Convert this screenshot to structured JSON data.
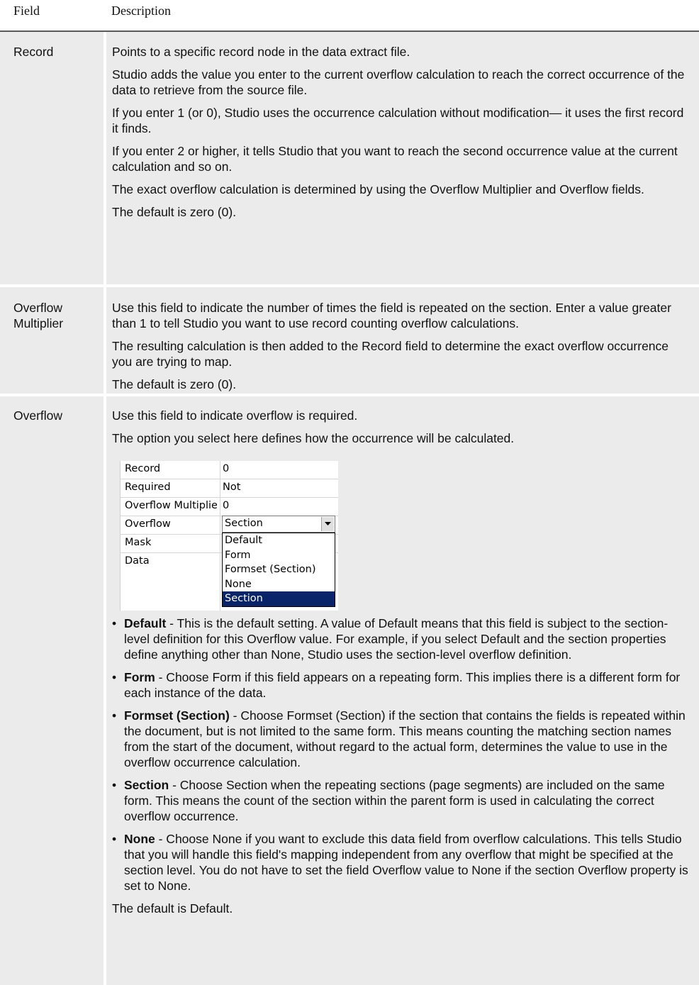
{
  "header": {
    "col_field": "Field",
    "col_description": "Description"
  },
  "rows": [
    {
      "field": "Record",
      "paragraphs": [
        "Points to a specific record node in the data extract file.",
        "Studio adds the value you enter to the current overflow calculation to reach the correct occurrence of the data to retrieve from the source file.",
        "If you enter 1 (or 0), Studio uses the occurrence calculation without modification— it uses the first record it finds.",
        "If you enter 2 or higher, it tells Studio that you want to reach the second occurrence value at the current calculation and so on.",
        "The exact overflow calculation is determined by using the Overflow Multiplier and Overflow fields.",
        "The default is zero (0)."
      ]
    },
    {
      "field": "Overflow Multiplier",
      "paragraphs": [
        "Use this field to indicate the number of times the field is repeated on the section. Enter a value greater than 1 to tell Studio you want to use record counting overflow calculations.",
        "The resulting calculation is then added to the Record field to determine the exact overflow occurrence you are trying to map.",
        "The default is zero (0)."
      ]
    },
    {
      "field": "Overflow",
      "intro": [
        "Use this field to indicate overflow is required.",
        "The option you select here defines how the occurrence will be calculated."
      ],
      "property_grid": {
        "rows": [
          {
            "key": "Record",
            "value": "0"
          },
          {
            "key": "Required",
            "value": "Not"
          },
          {
            "key": "Overflow Multiplier",
            "value": "0"
          },
          {
            "key": "Overflow",
            "value": "Section"
          },
          {
            "key": "Mask",
            "value": ""
          },
          {
            "key": "Data",
            "value": ""
          }
        ],
        "dropdown_options": [
          "Default",
          "Form",
          "Formset (Section)",
          "None",
          "Section"
        ],
        "selected_option": "Section"
      },
      "bullets": [
        {
          "term": "Default",
          "text": " - This is the default setting. A value of Default means that this field is subject to the section-level definition for this Overflow value. For example, if you select Default and the section properties define anything other than None, Studio uses the section-level overflow definition."
        },
        {
          "term": "Form",
          "text": " - Choose Form if this field appears on a repeating form. This implies there is a different form for each instance of the data."
        },
        {
          "term": "Formset (Section)",
          "text": " - Choose Formset (Section) if the section that contains the fields is repeated within the document, but is not limited to the same form. This means counting the matching section names from the start of the document, without regard to the actual form, determines the value to use in the overflow occurrence calculation."
        },
        {
          "term": "Section",
          "text": " - Choose Section when the repeating sections (page segments) are included on the same form. This means the count of the section within the parent form is used in calculating the correct overflow occurrence."
        },
        {
          "term": "None",
          "text": " - Choose None if you want to exclude this data field from overflow calculations. This tells Studio that you will handle this field's mapping independent from any overflow that might be specified at the section level. You do not have to set the field Overflow value to None if the section Overflow property is set to None."
        }
      ],
      "closing": "The default is Default."
    }
  ],
  "colors": {
    "row_background": "#ebebeb",
    "header_rule": "#5a5a5a",
    "selection": "#0a246a"
  }
}
